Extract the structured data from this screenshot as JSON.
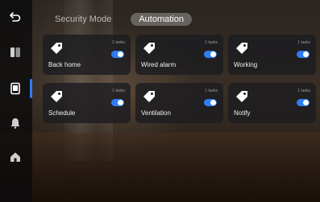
{
  "nav": {
    "items": [
      {
        "icon": "back-arrow-icon"
      },
      {
        "icon": "panel-icon"
      },
      {
        "icon": "tablet-icon",
        "active": true
      },
      {
        "icon": "bell-icon"
      },
      {
        "icon": "home-icon"
      }
    ]
  },
  "tabs": [
    {
      "label": "Security Mode",
      "active": false
    },
    {
      "label": "Automation",
      "active": true
    }
  ],
  "automations": [
    {
      "name": "Back home",
      "tasks": "1 tasks",
      "enabled": true
    },
    {
      "name": "Wired alarm",
      "tasks": "1 tasks",
      "enabled": true
    },
    {
      "name": "Working",
      "tasks": "1 tasks",
      "enabled": true
    },
    {
      "name": "Schedule",
      "tasks": "1 tasks",
      "enabled": true
    },
    {
      "name": "Ventilation",
      "tasks": "1 tasks",
      "enabled": true
    },
    {
      "name": "Notify",
      "tasks": "1 tasks",
      "enabled": true
    }
  ],
  "colors": {
    "accent": "#2f7df6",
    "card_bg": "#1c1c20",
    "sidebar_bg": "#0a0a0c"
  }
}
